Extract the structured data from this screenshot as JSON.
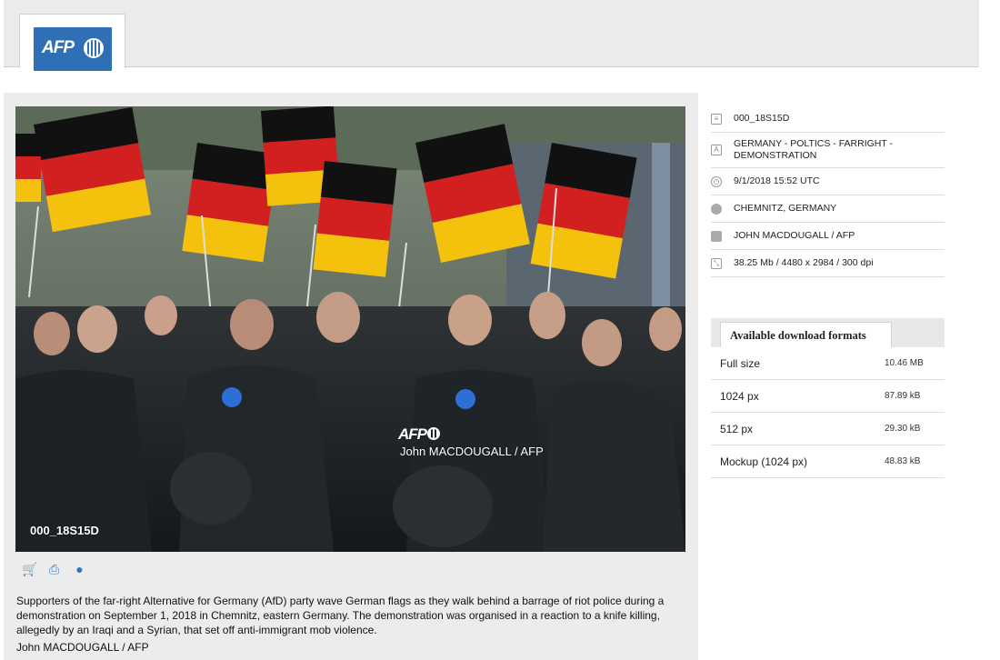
{
  "header": {
    "logo_text": "AFP"
  },
  "photo": {
    "watermark_logo": "AFP",
    "watermark_credit": "John MACDOUGALL / AFP",
    "watermark_id": "000_18S15D"
  },
  "actions": [
    {
      "icon": "cart-icon",
      "glyph": "🛒"
    },
    {
      "icon": "print-icon",
      "glyph": "⎙"
    },
    {
      "icon": "globe-icon",
      "glyph": "●"
    }
  ],
  "caption": "Supporters of the far-right Alternative for Germany (AfD) party wave German flags as they walk behind a barrage of riot police during a demonstration on September 1, 2018 in Chemnitz, eastern Germany. The demonstration was organised in a reaction to a knife killing, allegedly by an Iraqi and a Syrian, that set off anti-immigrant mob violence.",
  "credit_line": "John MACDOUGALL / AFP",
  "metadata": [
    {
      "icon": "document-icon",
      "value": "000_18S15D"
    },
    {
      "icon": "text-icon",
      "value": "GERMANY - POLTICS - FARRIGHT - DEMONSTRATION"
    },
    {
      "icon": "clock-icon",
      "value": "9/1/2018 15:52 UTC"
    },
    {
      "icon": "globe-icon",
      "value": "CHEMNITZ, GERMANY"
    },
    {
      "icon": "camera-icon",
      "value": "JOHN MACDOUGALL / AFP"
    },
    {
      "icon": "resize-icon",
      "value": "38.25 Mb / 4480 x 2984 / 300 dpi"
    }
  ],
  "downloads": {
    "title": "Available download formats",
    "items": [
      {
        "name": "Full size",
        "size": "10.46 MB"
      },
      {
        "name": "1024 px",
        "size": "87.89 kB"
      },
      {
        "name": "512 px",
        "size": "29.30 kB"
      },
      {
        "name": "Mockup (1024 px)",
        "size": "48.83 kB"
      }
    ]
  },
  "colors": {
    "brand_blue": "#2f6fb5",
    "action_blue": "#2f78c4",
    "flag_black": "#111111",
    "flag_red": "#d21f1f",
    "flag_gold": "#f4c20d"
  }
}
